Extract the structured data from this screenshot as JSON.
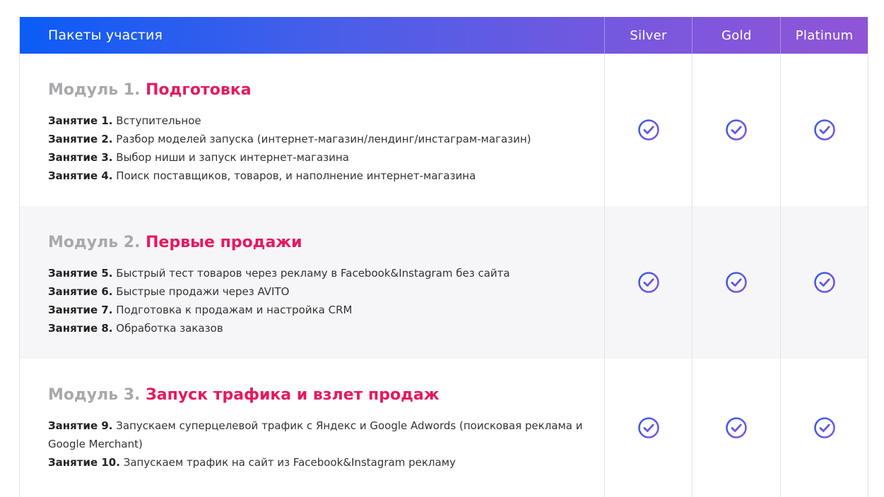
{
  "header": {
    "title": "Пакеты участия",
    "columns": [
      "Silver",
      "Gold",
      "Platinum"
    ]
  },
  "modules": [
    {
      "number": "Модуль 1.",
      "name": "Подготовка",
      "lessons": [
        {
          "label": "Занятие 1.",
          "text": "Вступительное"
        },
        {
          "label": "Занятие 2.",
          "text": "Разбор моделей запуска (интернет-магазин/лендинг/инстаграм-магазин)"
        },
        {
          "label": "Занятие 3.",
          "text": "Выбор ниши и запуск интернет-магазина"
        },
        {
          "label": "Занятие 4.",
          "text": "Поиск поставщиков, товаров, и наполнение интернет-магазина"
        }
      ],
      "included": [
        true,
        true,
        true
      ]
    },
    {
      "number": "Модуль 2.",
      "name": "Первые продажи",
      "lessons": [
        {
          "label": "Занятие 5.",
          "text": "Быстрый тест товаров через рекламу в Facebook&Instagram без сайта"
        },
        {
          "label": "Занятие 6.",
          "text": "Быстрые продажи через AVITO"
        },
        {
          "label": "Занятие 7.",
          "text": "Подготовка к продажам и настройка CRM"
        },
        {
          "label": "Занятие 8.",
          "text": "Обработка заказов"
        }
      ],
      "included": [
        true,
        true,
        true
      ]
    },
    {
      "number": "Модуль 3.",
      "name": "Запуск трафика и взлет продаж",
      "lessons": [
        {
          "label": "Занятие 9.",
          "text": "Запускаем суперцелевой трафик с Яндекс и Google Adwords (поисковая реклама и Google Merchant)"
        },
        {
          "label": "Занятие 10.",
          "text": "Запускаем трафик на сайт из Facebook&Instagram рекламу"
        }
      ],
      "included": [
        true,
        true,
        true
      ]
    }
  ],
  "colors": {
    "gradient_start": "#0b5cf6",
    "gradient_end": "#8f55d6",
    "accent": "#e5195f",
    "muted": "#a8a8ad",
    "row_alt": "#f6f6f8"
  },
  "icons": {
    "included": "check-circle-icon"
  }
}
